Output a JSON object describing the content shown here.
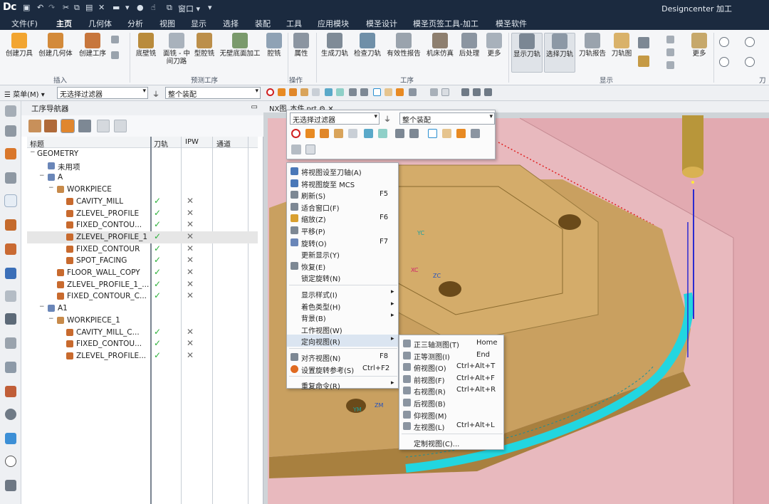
{
  "titlebar": {
    "logo": "Dc",
    "window_menu": "窗口",
    "app_title": "Designcenter 加工"
  },
  "menubar": [
    "文件(F)",
    "主页",
    "几何体",
    "分析",
    "视图",
    "显示",
    "选择",
    "装配",
    "工具",
    "应用模块",
    "模圣设计",
    "模圣页签工具-加工",
    "模圣软件"
  ],
  "ribbon": {
    "buttons": [
      "创建刀具",
      "创建几何体",
      "创建工序",
      "底壁铣",
      "面铣 - 中间刀路",
      "型腔铣",
      "无壁底面加工",
      "腔铣",
      "属性",
      "生成刀轨",
      "检查刀轨",
      "有效性报告",
      "机床仿真",
      "后处理",
      "更多",
      "显示刀轨",
      "选择刀轨",
      "刀轨报告",
      "刀轨图",
      "更多"
    ],
    "groups": [
      "插入",
      "预测工序",
      "操作",
      "工序",
      "显示",
      "刀轨"
    ]
  },
  "selbar": {
    "menu_label": "菜单(M)",
    "filter_value": "无选择过滤器",
    "assembly_value": "整个装配"
  },
  "navigator": {
    "title": "工序导航器",
    "columns": [
      "标题",
      "刀轨",
      "IPW",
      "通道"
    ],
    "rows": [
      {
        "label": "GEOMETRY",
        "level": 0,
        "exp": "−",
        "checks": false
      },
      {
        "label": "未用项",
        "level": 1,
        "exp": "",
        "checks": false
      },
      {
        "label": "A",
        "level": 1,
        "exp": "−",
        "checks": false
      },
      {
        "label": "WORKPIECE",
        "level": 2,
        "exp": "−",
        "checks": false
      },
      {
        "label": "CAVITY_MILL",
        "level": 3,
        "exp": "",
        "checks": true
      },
      {
        "label": "ZLEVEL_PROFILE",
        "level": 3,
        "exp": "",
        "checks": true
      },
      {
        "label": "FIXED_CONTOU...",
        "level": 3,
        "exp": "",
        "checks": true
      },
      {
        "label": "ZLEVEL_PROFILE_1",
        "level": 3,
        "exp": "",
        "checks": true,
        "selected": true
      },
      {
        "label": "FIXED_CONTOUR",
        "level": 3,
        "exp": "",
        "checks": true
      },
      {
        "label": "SPOT_FACING",
        "level": 3,
        "exp": "",
        "checks": true
      },
      {
        "label": "FLOOR_WALL_COPY",
        "level": 2,
        "exp": "",
        "checks": true
      },
      {
        "label": "ZLEVEL_PROFILE_1_...",
        "level": 2,
        "exp": "",
        "checks": true
      },
      {
        "label": "FIXED_CONTOUR_C...",
        "level": 2,
        "exp": "",
        "checks": true
      },
      {
        "label": "A1",
        "level": 1,
        "exp": "−",
        "checks": false
      },
      {
        "label": "WORKPIECE_1",
        "level": 2,
        "exp": "−",
        "checks": false
      },
      {
        "label": "CAVITY_MILL_C...",
        "level": 3,
        "exp": "",
        "checks": true
      },
      {
        "label": "FIXED_CONTOU...",
        "level": 3,
        "exp": "",
        "checks": true
      },
      {
        "label": "ZLEVEL_PROFILE...",
        "level": 3,
        "exp": "",
        "checks": true
      }
    ],
    "check_mark": "✓",
    "cross_mark": "✕"
  },
  "viewport": {
    "tab": "NX图_本件.prt  ⚙ ✕",
    "filter_value": "无选择过滤器",
    "assembly_value": "整个装配",
    "axis_labels": [
      "YC",
      "XC",
      "ZC",
      "YM",
      "ZM"
    ]
  },
  "context_menu": [
    {
      "text": "将视图设至刀轴(A)",
      "key": ""
    },
    {
      "text": "将视图旋至 MCS",
      "key": ""
    },
    {
      "text": "刷新(S)",
      "key": "F5"
    },
    {
      "text": "适合窗口(F)",
      "key": ""
    },
    {
      "text": "缩放(Z)",
      "key": "F6"
    },
    {
      "text": "平移(P)",
      "key": ""
    },
    {
      "text": "旋转(O)",
      "key": "F7"
    },
    {
      "text": "更新显示(Y)",
      "key": ""
    },
    {
      "text": "恢复(E)",
      "key": ""
    },
    {
      "text": "锁定旋转(N)",
      "key": ""
    },
    {
      "text": "显示样式(I)",
      "key": "",
      "sub": true
    },
    {
      "text": "着色类型(H)",
      "key": "",
      "sub": true
    },
    {
      "text": "背景(B)",
      "key": "",
      "sub": true
    },
    {
      "text": "工作视图(W)",
      "key": ""
    },
    {
      "text": "定向视图(R)",
      "key": "",
      "sub": true,
      "highlight": true
    },
    {
      "text": "对齐视图(N)",
      "key": "F8"
    },
    {
      "text": "设置旋转参考(S)",
      "key": "Ctrl+F2"
    },
    {
      "text": "重复命令(R)",
      "key": "",
      "sub": true
    }
  ],
  "submenu": [
    {
      "text": "正三轴测图(T)",
      "key": "Home"
    },
    {
      "text": "正等测图(I)",
      "key": "End"
    },
    {
      "text": "俯视图(O)",
      "key": "Ctrl+Alt+T"
    },
    {
      "text": "前视图(F)",
      "key": "Ctrl+Alt+F"
    },
    {
      "text": "右视图(R)",
      "key": "Ctrl+Alt+R"
    },
    {
      "text": "后视图(B)",
      "key": ""
    },
    {
      "text": "仰视图(M)",
      "key": ""
    },
    {
      "text": "左视图(L)",
      "key": "Ctrl+Alt+L"
    },
    {
      "text": "定制视图(C)...",
      "key": ""
    }
  ],
  "colors": {
    "titlebar": "#1b2a3f",
    "part_body": "#c9a060",
    "blank_box": "#e6b8bd",
    "toolpath": "#22d6e0",
    "tool": "#b8963a"
  }
}
